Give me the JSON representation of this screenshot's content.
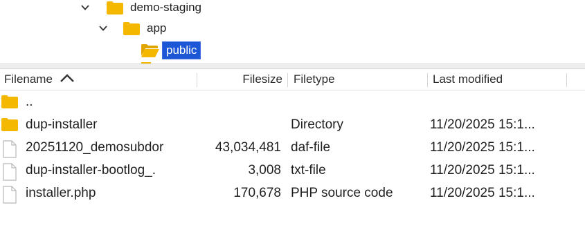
{
  "tree": {
    "items": [
      {
        "label": "demo-staging",
        "expanded": true
      },
      {
        "label": "app",
        "expanded": true
      },
      {
        "label": "public",
        "selected": true
      }
    ]
  },
  "colors": {
    "folder": "#f5b800",
    "selection": "#1d57d6"
  },
  "table": {
    "columns": {
      "filename": "Filename",
      "filesize": "Filesize",
      "filetype": "Filetype",
      "modified": "Last modified"
    },
    "sort": {
      "column": "Filename",
      "direction": "ascending"
    },
    "rows": [
      {
        "icon": "folder-icon",
        "name": "..",
        "size": "",
        "type": "",
        "modified": ""
      },
      {
        "icon": "folder-icon",
        "name": "dup-installer",
        "size": "",
        "type": "Directory",
        "modified": "11/20/2025 15:1..."
      },
      {
        "icon": "file-icon",
        "name": "20251120_demosubdor",
        "size": "43,034,481",
        "type": "daf-file",
        "modified": "11/20/2025 15:1..."
      },
      {
        "icon": "file-icon",
        "name": "dup-installer-bootlog_.",
        "size": "3,008",
        "type": "txt-file",
        "modified": "11/20/2025 15:1..."
      },
      {
        "icon": "file-icon",
        "name": "installer.php",
        "size": "170,678",
        "type": "PHP source code",
        "modified": "11/20/2025 15:1..."
      }
    ]
  }
}
